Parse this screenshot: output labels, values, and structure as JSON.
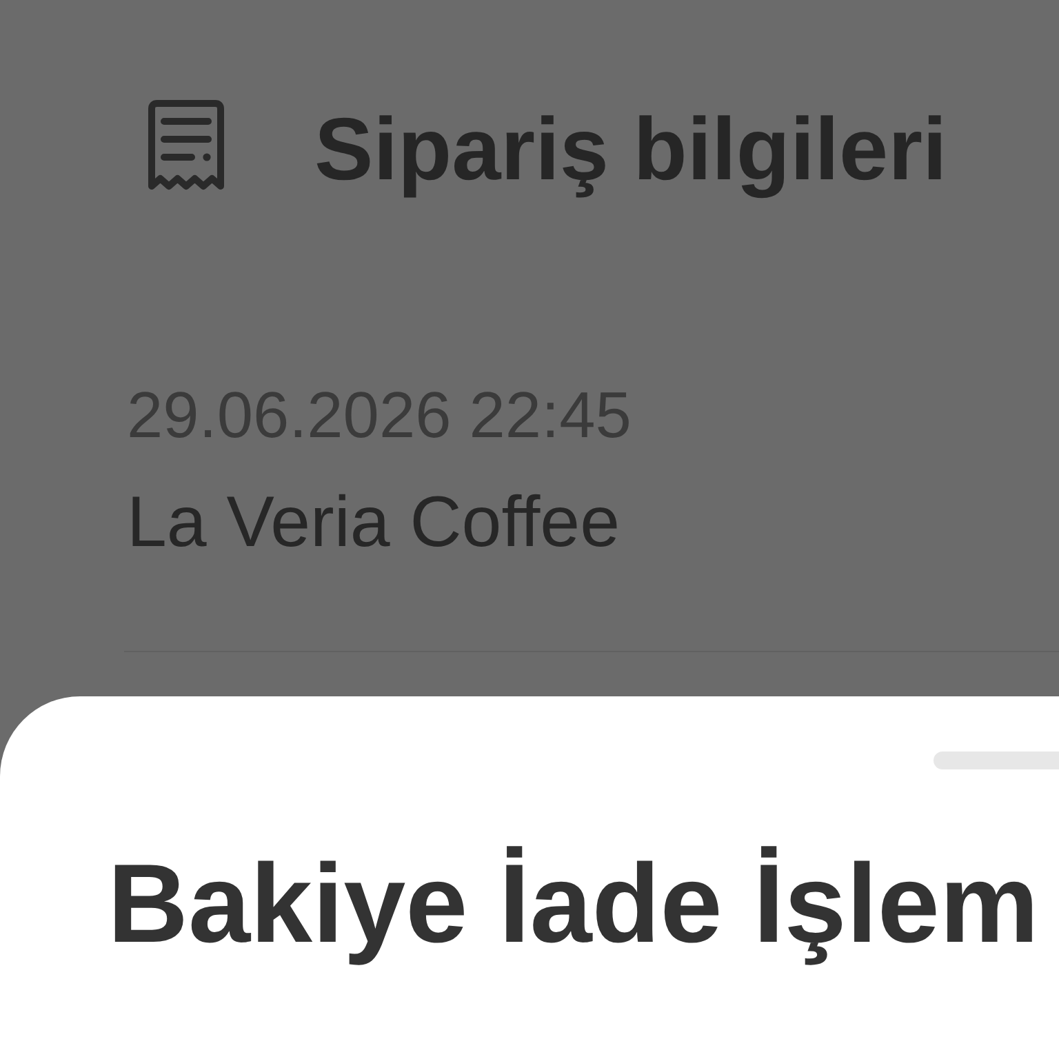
{
  "header": {
    "title": "Sipariş bilgileri"
  },
  "order": {
    "date_time": "29.06.2026 22:45",
    "merchant": "La Veria Coffee"
  },
  "sheet": {
    "title": "Bakiye İade İşlem"
  }
}
